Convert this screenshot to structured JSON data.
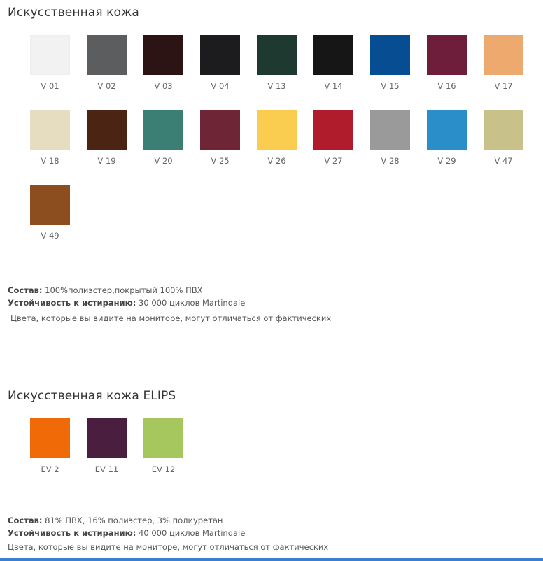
{
  "section1": {
    "title": "Искусственная кожа",
    "swatches": [
      {
        "code": "V 01",
        "color": "#f2f2f2",
        "light": true
      },
      {
        "code": "V 02",
        "color": "#5b5d5e"
      },
      {
        "code": "V 03",
        "color": "#2d1414"
      },
      {
        "code": "V 04",
        "color": "#1c1c1e"
      },
      {
        "code": "V 13",
        "color": "#1e3a30"
      },
      {
        "code": "V 14",
        "color": "#161616"
      },
      {
        "code": "V 15",
        "color": "#064e91"
      },
      {
        "code": "V 16",
        "color": "#6e1d3b"
      },
      {
        "code": "V 17",
        "color": "#eeaa6e"
      },
      {
        "code": "V 18",
        "color": "#e6dcc0"
      },
      {
        "code": "V 19",
        "color": "#4c2414"
      },
      {
        "code": "V 20",
        "color": "#3a7e74"
      },
      {
        "code": "V 25",
        "color": "#6e2636"
      },
      {
        "code": "V 26",
        "color": "#facc50"
      },
      {
        "code": "V 27",
        "color": "#b01c2c"
      },
      {
        "code": "V 28",
        "color": "#9a9a9a"
      },
      {
        "code": "V 29",
        "color": "#2a8ec8"
      },
      {
        "code": "V 47",
        "color": "#c8c28a"
      },
      {
        "code": "V 49",
        "color": "#8c4e1e"
      }
    ],
    "composition_label": "Состав:",
    "composition_value": " 100%полиэстер,покрытый 100% ПВХ",
    "abrasion_label": "Устойчивость к истиранию:",
    "abrasion_value": " 30 000 циклов Martindale",
    "note": "Цвета, которые вы видите на мониторе, могут отличаться от фактических"
  },
  "section2": {
    "title": "Искусственная кожа ELIPS",
    "swatches": [
      {
        "code": "EV 2",
        "color": "#f06a08"
      },
      {
        "code": "EV 11",
        "color": "#4a1e3e"
      },
      {
        "code": "EV 12",
        "color": "#a6c65e"
      }
    ],
    "composition_label": "Состав:",
    "composition_value": " 81% ПВХ, 16% полиэстер, 3% полиуретан",
    "abrasion_label": "Устойчивость к истиранию:",
    "abrasion_value": " 40 000 циклов Martindale",
    "note": "Цвета, которые вы видите на мониторе, могут отличаться от фактических"
  },
  "colors": {
    "bottom_bar": "#3b7fd0"
  }
}
